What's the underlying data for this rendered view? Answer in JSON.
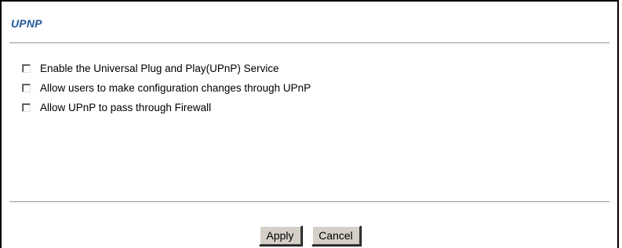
{
  "section": {
    "title": "UPNP"
  },
  "options": [
    {
      "label": "Enable the Universal Plug and Play(UPnP) Service",
      "checked": false
    },
    {
      "label": "Allow users to make configuration changes through UPnP",
      "checked": false
    },
    {
      "label": "Allow UPnP to pass through Firewall",
      "checked": false
    }
  ],
  "buttons": {
    "apply_label": "Apply",
    "cancel_label": "Cancel"
  },
  "colors": {
    "title": "#1f5a99",
    "button_face": "#d4d0c8",
    "divider": "#a8a8a8"
  }
}
